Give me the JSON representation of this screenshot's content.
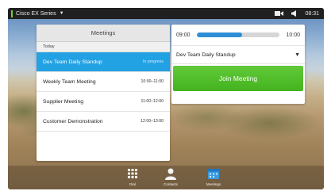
{
  "statusbar": {
    "device_name": "Cisco EX Series",
    "time": "08:31",
    "icons": [
      "camera-icon",
      "speaker-icon"
    ]
  },
  "meetings_panel": {
    "title": "Meetings",
    "section_label": "Today",
    "items": [
      {
        "title": "Dev Team Daily Standup",
        "time": "In progress",
        "active": true
      },
      {
        "title": "Weekly Team Meeting",
        "time": "10:00–11:00",
        "active": false
      },
      {
        "title": "Supplier Meeting",
        "time": "11:00–12:00",
        "active": false
      },
      {
        "title": "Customer Demonstration",
        "time": "12:00–13:00",
        "active": false
      }
    ]
  },
  "detail_panel": {
    "time_start": "09:00",
    "time_end": "10:00",
    "progress": 0.55,
    "selected_meeting": "Dev Team Daily Standup",
    "join_label": "Join Meeting"
  },
  "dock": {
    "items": [
      {
        "label": "Dial",
        "icon": "dialpad-icon"
      },
      {
        "label": "Contacts",
        "icon": "contacts-icon"
      },
      {
        "label": "Meetings",
        "icon": "meetings-icon"
      }
    ]
  },
  "colors": {
    "accent_blue": "#22a1e3",
    "join_green": "#43b31e",
    "status_green": "#6fd13a",
    "progress_blue": "#2f8fd6"
  }
}
